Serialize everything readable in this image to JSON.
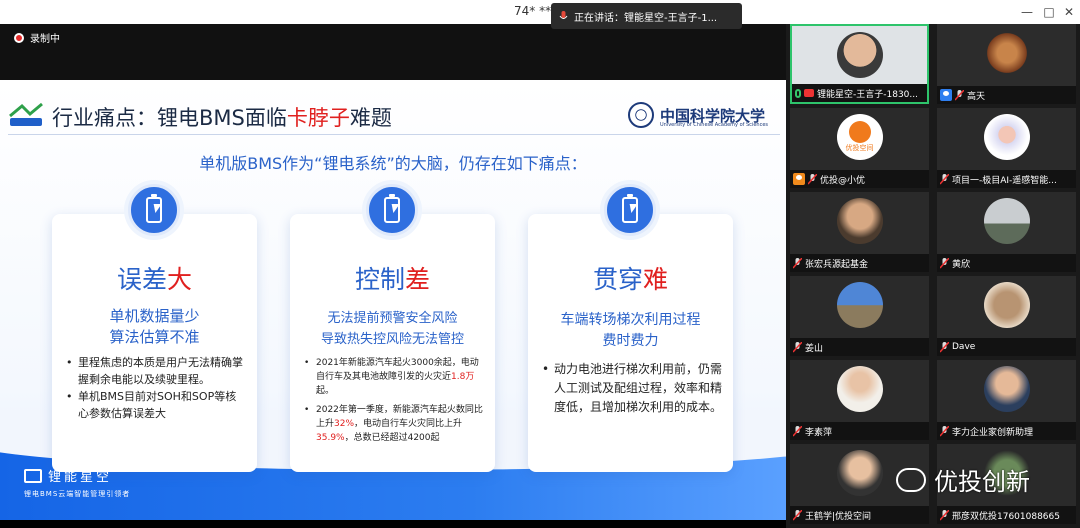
{
  "window": {
    "title": "74* ***",
    "speaking": "正在讲话：锂能星空-王言子-1...",
    "controls": [
      "—",
      "□",
      "✕"
    ]
  },
  "recording": {
    "label": "录制中"
  },
  "slide": {
    "title_pre": "行业痛点：锂电BMS面临",
    "title_hl": "卡脖子",
    "title_post": "难题",
    "logo_text": "锂能星空",
    "university": "中国科学院大学",
    "university_en": "University of Chinese Academy of Sciences",
    "subtitle": "单机版BMS作为“锂电系统”的大脑，仍存在如下痛点：",
    "cards": [
      {
        "head_pre": "误差",
        "head_red": "大",
        "sub1": "单机数据量少",
        "sub2": "算法估算不准",
        "b1": "里程焦虑的本质是用户无法精确掌握剩余电能以及续驶里程。",
        "b2": "单机BMS目前对SOH和SOP等核心参数估算误差大"
      },
      {
        "head_pre": "控制",
        "head_red": "差",
        "sub1": "无法提前预警安全风险",
        "sub2": "导致热失控风险无法管控",
        "b1_pre": "2021年新能源汽车起火3000余起，电动自行车及其电池故障引发的火灾近",
        "b1_red": "1.8万",
        "b1_post": "起。",
        "b2_pre": "2022年第一季度，新能源汽车起火数同比上升",
        "b2_red1": "32%",
        "b2_mid": "，电动自行车火灾同比上升",
        "b2_red2": "35.9%",
        "b2_post": "，总数已经超过4200起"
      },
      {
        "head_pre": "贯穿",
        "head_red": "难",
        "sub1": "车端转场梯次利用过程",
        "sub2": "费时费力",
        "b1": "动力电池进行梯次利用前，仍需人工测试及配组过程，效率和精度低，且增加梯次利用的成本。"
      }
    ],
    "brand_name": "锂能星空",
    "brand_tag": "锂电BMS云端智能管理引领者"
  },
  "participants": [
    {
      "name": "锂能星空-王言子-1830...",
      "active": true
    },
    {
      "name": "高天"
    },
    {
      "name": "优投@小优"
    },
    {
      "name": "项目一-极目AI-遥感智能..."
    },
    {
      "name": "张宏兵源起基金"
    },
    {
      "name": "黄欣"
    },
    {
      "name": "姜山"
    },
    {
      "name": "Dave"
    },
    {
      "name": "李素萍"
    },
    {
      "name": "李力企业家创新助理"
    },
    {
      "name": "王鹤学|优投空间"
    },
    {
      "name": "邢彦双优投17601088665"
    }
  ],
  "avatar_texts": {
    "youtou_logo": "优投空间"
  },
  "watermark": {
    "text": "优投创新"
  },
  "colors": {
    "accent_blue": "#2a62c9",
    "accent_red": "#e0201f",
    "active_border": "#2ec46b"
  }
}
